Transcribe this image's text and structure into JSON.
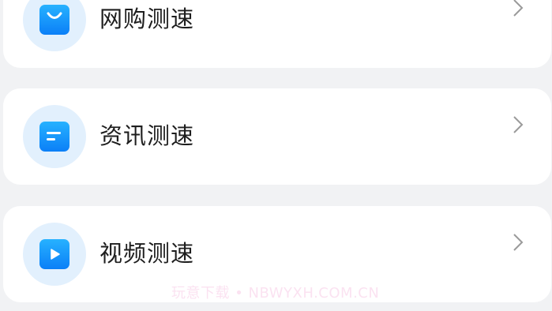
{
  "items": [
    {
      "label": "网购测速",
      "icon": "shopping-bag-icon"
    },
    {
      "label": "资讯测速",
      "icon": "news-icon"
    },
    {
      "label": "视频测速",
      "icon": "video-play-icon"
    }
  ],
  "watermark": "玩意下载 • NBWYXH.COM.CN",
  "colors": {
    "background": "#f1f2f4",
    "card": "#ffffff",
    "icon_circle": "#e2f0fd",
    "icon_tile": "#1a96fb",
    "text": "#1e1e1e",
    "chevron": "#9a9a9a"
  }
}
